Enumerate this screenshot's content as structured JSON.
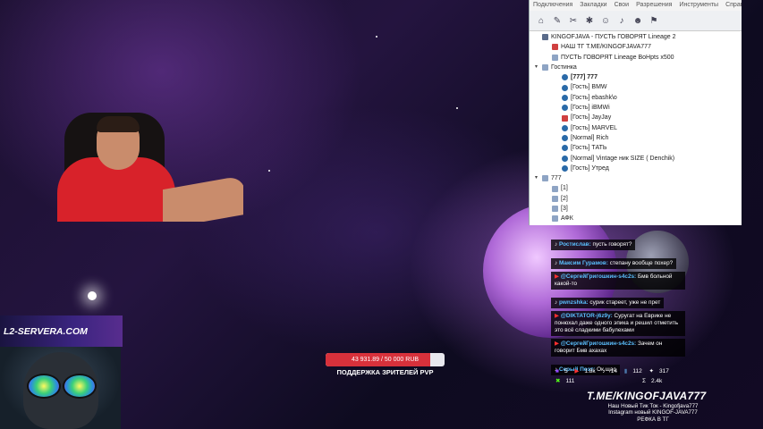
{
  "client": {
    "menu": [
      "Подключения",
      "Закладки",
      "Свои",
      "Разрешения",
      "Инструменты",
      "Справка"
    ],
    "toolbar_icons": [
      "connect-icon",
      "disconnect-icon",
      "bookmark-icon",
      "settings-icon",
      "away-icon",
      "mic-icon",
      "user-icon",
      "plugin-icon"
    ],
    "tree": [
      {
        "level": 0,
        "icon": "server",
        "text": "KINGOFJAVA - ПУСТЬ ГОВОРЯТ Lineage 2",
        "bold": false
      },
      {
        "level": 1,
        "icon": "red",
        "text": "НАШ ТГ T.ME/KINGOFJAVA777",
        "bold": false
      },
      {
        "level": 1,
        "icon": "channel",
        "text": "ПУСТЬ ГОВОРЯТ Lineage BoHpts x500",
        "bold": false
      },
      {
        "level": 0,
        "icon": "channel",
        "expander": "v",
        "text": "Гостинка",
        "bold": false
      },
      {
        "level": 2,
        "icon": "user",
        "text": "[777] 777",
        "bold": true
      },
      {
        "level": 2,
        "icon": "user",
        "text": "[Гость] BMW",
        "bold": false
      },
      {
        "level": 2,
        "icon": "user",
        "text": "[Гость] ebashk\\o",
        "bold": false
      },
      {
        "level": 2,
        "icon": "user",
        "text": "[Гость] iBMWi",
        "bold": false
      },
      {
        "level": 2,
        "icon": "red",
        "text": "[Гость] JayJay",
        "bold": false
      },
      {
        "level": 2,
        "icon": "user",
        "text": "[Гость] MARVEL",
        "bold": false
      },
      {
        "level": 2,
        "icon": "user",
        "text": "[Normal] Rich",
        "bold": false
      },
      {
        "level": 2,
        "icon": "user",
        "text": "[Гость] ТАТЬ",
        "bold": false
      },
      {
        "level": 2,
        "icon": "user",
        "text": "[Normal] Vintage ник SIZE ( Denchik)",
        "bold": false
      },
      {
        "level": 2,
        "icon": "user",
        "text": "[Гость] Утред",
        "bold": false
      },
      {
        "level": 0,
        "icon": "channel",
        "expander": "v",
        "text": "777",
        "bold": false
      },
      {
        "level": 1,
        "icon": "channel",
        "text": "[1]",
        "bold": false
      },
      {
        "level": 1,
        "icon": "channel",
        "text": "[2]",
        "bold": false
      },
      {
        "level": 1,
        "icon": "channel",
        "text": "[3]",
        "bold": false
      },
      {
        "level": 1,
        "icon": "channel",
        "text": "АФК",
        "bold": false
      }
    ]
  },
  "chat": [
    {
      "icon": "tiktok",
      "name": "Ростислав:",
      "text": " пусть говорят?"
    },
    {
      "icon": "tiktok",
      "name": "Максим Гурамов:",
      "text": " степану вообще похер?"
    },
    {
      "icon": "youtube",
      "name": "@СергейГригошкин-s4c2s:",
      "text": " Бмв больной какой-то"
    },
    {
      "icon": "tiktok",
      "name": "pwnzshka:",
      "text": " сурик стареет, уже не прет"
    },
    {
      "icon": "youtube",
      "name": "@DIKTATOR-j6z9y:",
      "text": " Суругат на Еврике не понюхал даже одного эпика и решил отметить это всё сладкими бабулехами"
    },
    {
      "icon": "youtube",
      "name": "@СергейГригошкин-s4c2s:",
      "text": " Зачем он говорит Бмв ахахах"
    },
    {
      "icon": "tiktok",
      "name": "Серый Поэт:",
      "text": " Ок щас"
    }
  ],
  "stats": [
    {
      "icon": "twitch-icon",
      "value": "5"
    },
    {
      "icon": "youtube-icon",
      "value": "1.8k"
    },
    {
      "icon": "tiktok-icon",
      "value": "14"
    },
    {
      "icon": "vk-icon",
      "value": "112"
    },
    {
      "icon": "likes-icon",
      "value": "317"
    },
    {
      "icon": "kick-icon",
      "value": "111"
    },
    {
      "icon": "total-icon",
      "value": "2.4k"
    }
  ],
  "donation": {
    "text": "43 931.89 / 50 000 RUB",
    "fraction": 0.8786,
    "caption": "ПОДДЕРЖКА ЗРИТЕЛЕЙ PVP"
  },
  "overlay": {
    "tme": "T.ME/KINGOFJAVA777",
    "promo": [
      "Наш Новый Тик Ток - Kingofjava777",
      "Instagram новый KINGOF-JAVA777",
      "РЕФКА В ТГ"
    ],
    "banner": "L2-SERVERA.COM"
  },
  "colors": {
    "accent": "#d7313b",
    "chat_name": "#5bc0ff"
  }
}
